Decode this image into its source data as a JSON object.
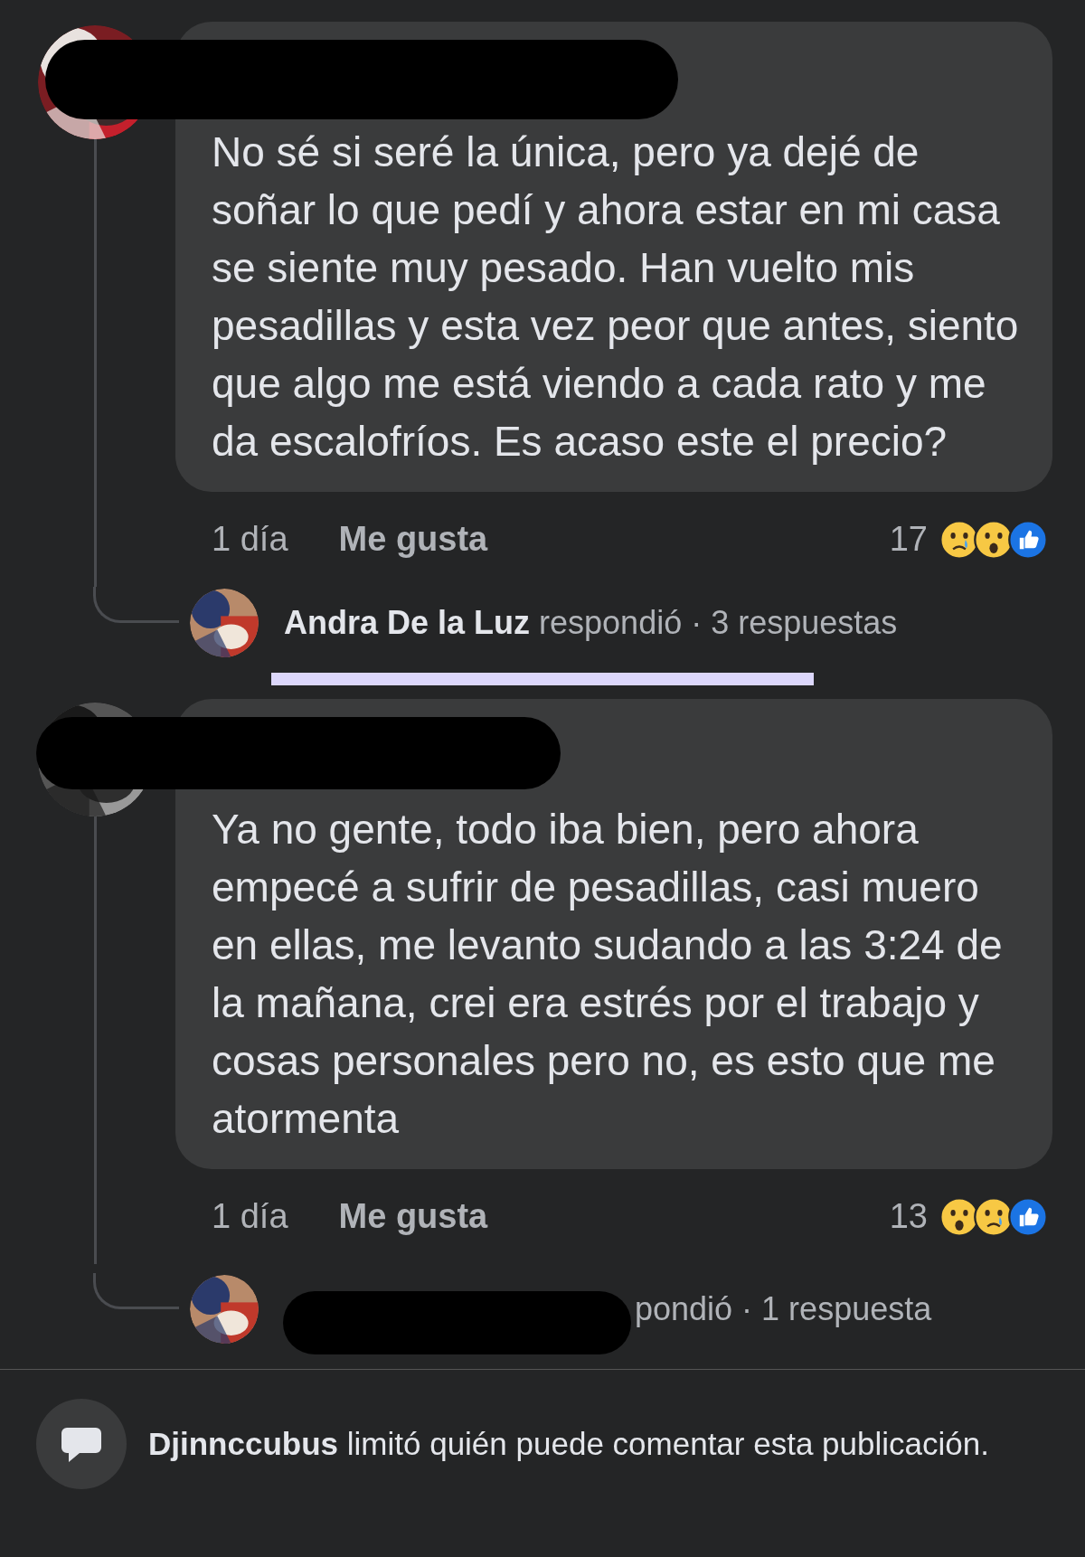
{
  "comments": [
    {
      "text": "No sé si seré la única, pero ya dejé de soñar lo que pedí y ahora estar en mi casa se siente muy pesado. Han vuelto mis pesadillas y esta vez peor que antes, siento que algo me está viendo a cada rato y me da escalofríos. Es acaso este el precio?",
      "time": "1 día",
      "like": "Me gusta",
      "reaction_count": "17",
      "reactions": [
        {
          "kind": "sad"
        },
        {
          "kind": "wow"
        },
        {
          "kind": "like"
        }
      ],
      "reply": {
        "name": "Andra De la Luz",
        "text": "respondió · 3 respuestas"
      }
    },
    {
      "text": "Ya no gente, todo iba bien, pero ahora empecé a sufrir de pesadillas, casi muero en ellas, me levanto sudando a las 3:24 de la mañana, crei era estrés por el trabajo y cosas personales pero no, es esto que me atormenta",
      "time": "1 día",
      "like": "Me gusta",
      "reaction_count": "13",
      "reactions": [
        {
          "kind": "wow"
        },
        {
          "kind": "sad"
        },
        {
          "kind": "like"
        }
      ],
      "reply": {
        "text": "pondió · 1 respuesta"
      }
    }
  ],
  "footer": {
    "name": "Djinnccubus",
    "text": "limitó quién puede comentar esta publicación."
  }
}
